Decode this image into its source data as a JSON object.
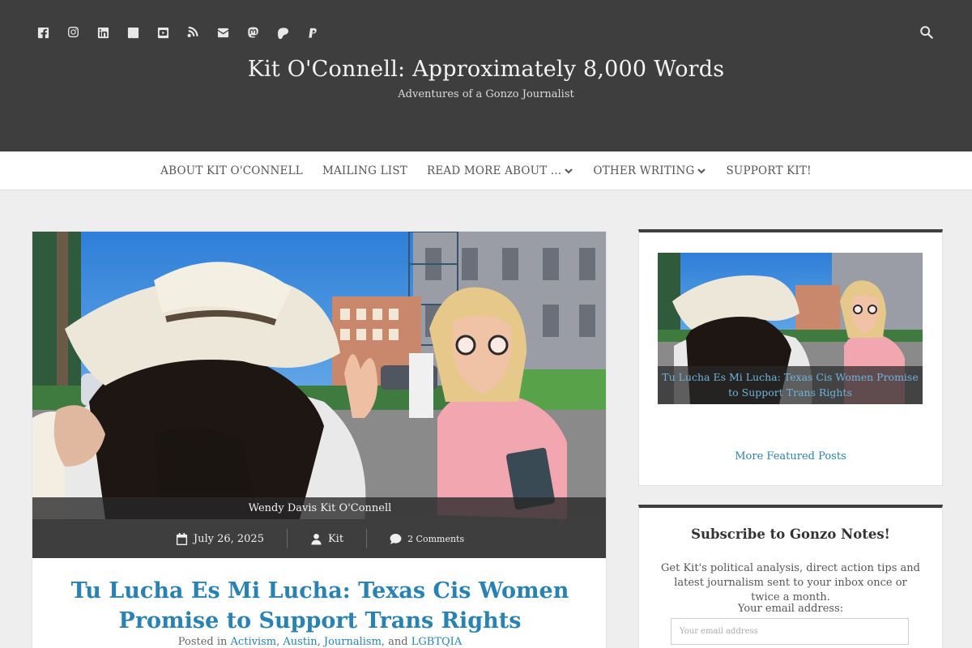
{
  "header": {
    "title": "Kit O'Connell: Approximately 8,000 Words",
    "tagline": "Adventures of a Gonzo Journalist",
    "social_icons": [
      "facebook-icon",
      "instagram-icon",
      "linkedin-icon",
      "pinterest-icon",
      "youtube-icon",
      "rss-icon",
      "email-icon",
      "mastodon-icon",
      "patreon-icon",
      "paypal-icon"
    ],
    "search_icon": "search-icon",
    "bg_color": "#3e3e3e"
  },
  "nav": {
    "items": [
      {
        "label": "ABOUT KIT O'CONNELL"
      },
      {
        "label": "MAILING LIST"
      },
      {
        "label": "READ MORE ABOUT ..."
      },
      {
        "label": "OTHER WRITING"
      },
      {
        "label": "SUPPORT KIT!"
      }
    ]
  },
  "article": {
    "image_caption": "Wendy Davis Kit O'Connell",
    "date": "July 26, 2025",
    "author": "Kit",
    "comments": "2 Comments",
    "title": "Tu Lucha Es Mi Lucha: Texas Cis Women Promise to Support Trans Rights",
    "posted_in_prefix": "Posted in",
    "categories": [
      "Activism",
      "Austin",
      "Journalism",
      "LGBTQIA"
    ],
    "cat_sep_1": ",",
    "cat_sep_2": ",",
    "cat_sep_3": ", and",
    "link_color": "#2a82b3"
  },
  "sidebar": {
    "featured": {
      "caption": "Tu Lucha Es Mi Lucha: Texas Cis Women Promise to Support Trans Rights",
      "more_link": "More Featured Posts"
    },
    "subscribe": {
      "title": "Subscribe to Gonzo Notes!",
      "description": "Get Kit's political analysis, direct action tips and latest journalism sent to your inbox once or twice a month.",
      "email_label": "Your email address:",
      "email_placeholder": "Your email address"
    }
  }
}
